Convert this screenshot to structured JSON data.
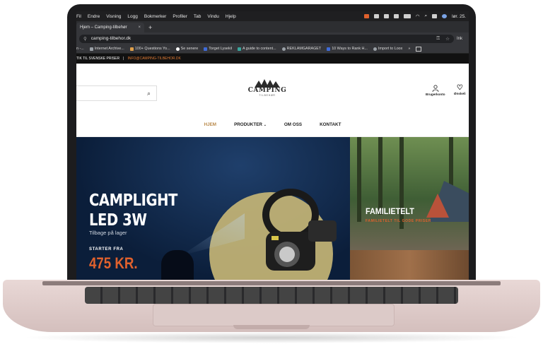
{
  "menubar": {
    "items": [
      "Fil",
      "Endre",
      "Visning",
      "Logg",
      "Bokmerker",
      "Profiler",
      "Tab",
      "Vindu",
      "Hjelp"
    ],
    "clock": "lør. 25."
  },
  "tab": {
    "title": "Hjem – Camping-tilbehør",
    "close": "×",
    "new": "+"
  },
  "omnibox": {
    "url": "camping-tilbehor.dk",
    "profile": "Ink"
  },
  "bookmarks": [
    {
      "label": "n -...",
      "icon": "page-icon"
    },
    {
      "label": "Internet Archive...",
      "icon": "archive-icon"
    },
    {
      "label": "100+ Questions Yo...",
      "icon": "folder-icon"
    },
    {
      "label": "Se senere",
      "icon": "google-icon"
    },
    {
      "label": "Torget Lysekil",
      "icon": "flag-icon"
    },
    {
      "label": "A guide to content...",
      "icon": "doc-icon"
    },
    {
      "label": "REKLAMGARAGET",
      "icon": "globe-icon"
    },
    {
      "label": "10 Ways to Rank H...",
      "icon": "link-icon"
    },
    {
      "label": "Import to Loox",
      "icon": "globe-icon"
    }
  ],
  "site": {
    "topbar": {
      "left": "TIK TIL SVENSKE PRISER",
      "sep": "|",
      "email": "INFO@CAMPING-TILBEHOR.DK"
    },
    "logo": {
      "word": "CAMPING",
      "sub": "TILBEHØR"
    },
    "account_label": "Brugerkonto",
    "wishlist_label": "Ønskeli",
    "nav": [
      {
        "label": "HJEM",
        "active": true
      },
      {
        "label": "PRODUKTER",
        "caret": "⌄"
      },
      {
        "label": "OM OSS"
      },
      {
        "label": "KONTAKT"
      }
    ],
    "hero": {
      "title_line1": "CAMPLIGHT",
      "title_line2": "LED 3W",
      "subtitle": "Tilbage på lager",
      "from_label": "STARTER FRA",
      "price": "475 KR."
    },
    "promo": {
      "title": "FAMILIETELT",
      "subtitle": "FAMILIETELT TIL GODE PRISER"
    }
  },
  "colors": {
    "accent": "#e0612d",
    "nav_active": "#b98a4b",
    "hero_bg": "#0b1e3a"
  }
}
